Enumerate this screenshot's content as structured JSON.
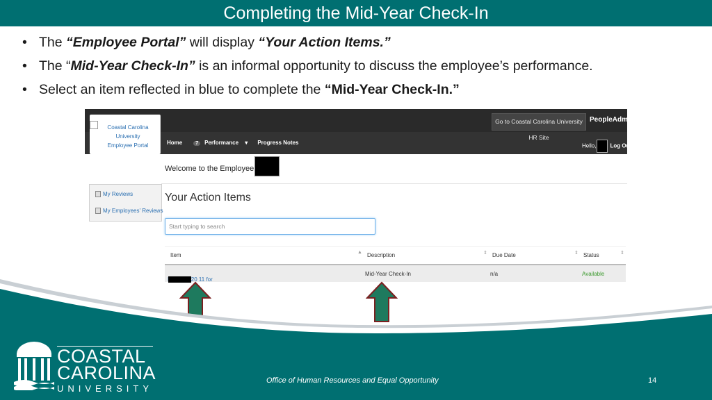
{
  "slide": {
    "title": "Completing the Mid-Year Check-In",
    "bullets": [
      {
        "pre": "The ",
        "q1": "“Employee Portal”",
        "mid": " will display ",
        "q2": "“Your Action Items.”",
        "post": ""
      },
      {
        "pre": "The “",
        "q1": "Mid-Year Check-In”",
        "mid": " is an informal opportunity to discuss the employee’s performance.",
        "q2": "",
        "post": ""
      },
      {
        "pre": "Select an item reflected in blue to complete the ",
        "q1": "“Mid-Year Check-In.”",
        "mid": "",
        "q2": "",
        "post": ""
      }
    ]
  },
  "portal": {
    "logo_line1": "Coastal Carolina University",
    "logo_line2": "Employee Portal",
    "hr_site_button": "Go to Coastal Carolina University HR Site",
    "brand": "PeopleAdmin",
    "nav": {
      "home": "Home",
      "home_badge": "7",
      "performance": "Performance",
      "progress_notes": "Progress Notes"
    },
    "hello": "Hello,",
    "logout": "Log Out",
    "welcome": "Welcome to the Employee Portal,",
    "sidebar": [
      {
        "label": "My Reviews"
      },
      {
        "label": "My Employees' Reviews"
      }
    ],
    "action_items_title": "Your Action Items",
    "search_placeholder": "Start typing to search",
    "table": {
      "headers": [
        "Item",
        "Description",
        "Due Date",
        "Status"
      ],
      "rows": [
        {
          "item": "EPMS 2020 11 for",
          "description": "Mid-Year Check-In",
          "due": "n/a",
          "status": "Available"
        }
      ]
    }
  },
  "footer": {
    "logo_line1": "COASTAL",
    "logo_line2": "CAROLINA",
    "logo_line3": "UNIVERSITY",
    "office": "Office of Human Resources and Equal Opportunity",
    "page": "14"
  },
  "colors": {
    "teal": "#006f71",
    "link_blue": "#2a6fb1",
    "status_green": "#3c9a2e",
    "arrow_green": "#1e7a5e"
  }
}
